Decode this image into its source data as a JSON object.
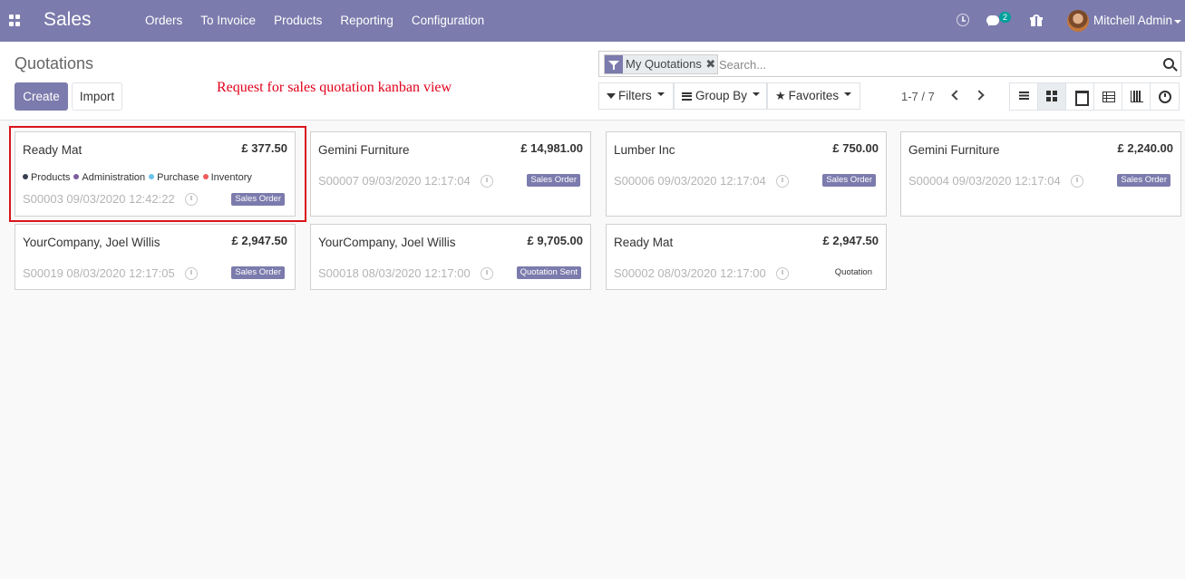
{
  "navbar": {
    "app_title": "Sales",
    "menu": [
      "Orders",
      "To Invoice",
      "Products",
      "Reporting",
      "Configuration"
    ],
    "message_count": "2",
    "user_name": "Mitchell Admin"
  },
  "control": {
    "breadcrumb": "Quotations",
    "create_label": "Create",
    "import_label": "Import",
    "annotation": "Request for sales quotation kanban view",
    "facet_label": "My Quotations",
    "facet_close": "✖",
    "search_placeholder": "Search...",
    "filters_label": "Filters",
    "groupby_label": "Group By",
    "favorites_label": "Favorites",
    "pager": "1-7 / 7"
  },
  "tags": [
    {
      "name": "Products",
      "color": "#374151"
    },
    {
      "name": "Administration",
      "color": "#7c5ea0"
    },
    {
      "name": "Purchase",
      "color": "#6cc1ed"
    },
    {
      "name": "Inventory",
      "color": "#ef5b5b"
    }
  ],
  "cards": [
    {
      "partner": "Ready Mat",
      "amount": "£ 377.50",
      "reference": "S00003 09/03/2020 12:42:22",
      "state": "Sales Order",
      "state_style": "primary"
    },
    {
      "partner": "Gemini Furniture",
      "amount": "£ 14,981.00",
      "reference": "S00007 09/03/2020 12:17:04",
      "state": "Sales Order",
      "state_style": "primary"
    },
    {
      "partner": "Lumber Inc",
      "amount": "£ 750.00",
      "reference": "S00006 09/03/2020 12:17:04",
      "state": "Sales Order",
      "state_style": "primary"
    },
    {
      "partner": "Gemini Furniture",
      "amount": "£ 2,240.00",
      "reference": "S00004 09/03/2020 12:17:04",
      "state": "Sales Order",
      "state_style": "primary"
    },
    {
      "partner": "YourCompany, Joel Willis",
      "amount": "£ 2,947.50",
      "reference": "S00019 08/03/2020 12:17:05",
      "state": "Sales Order",
      "state_style": "primary"
    },
    {
      "partner": "YourCompany, Joel Willis",
      "amount": "£ 9,705.00",
      "reference": "S00018 08/03/2020 12:17:00",
      "state": "Quotation Sent",
      "state_style": "primary"
    },
    {
      "partner": "Ready Mat",
      "amount": "£ 2,947.50",
      "reference": "S00002 08/03/2020 12:17:00",
      "state": "Quotation",
      "state_style": "plain"
    }
  ]
}
